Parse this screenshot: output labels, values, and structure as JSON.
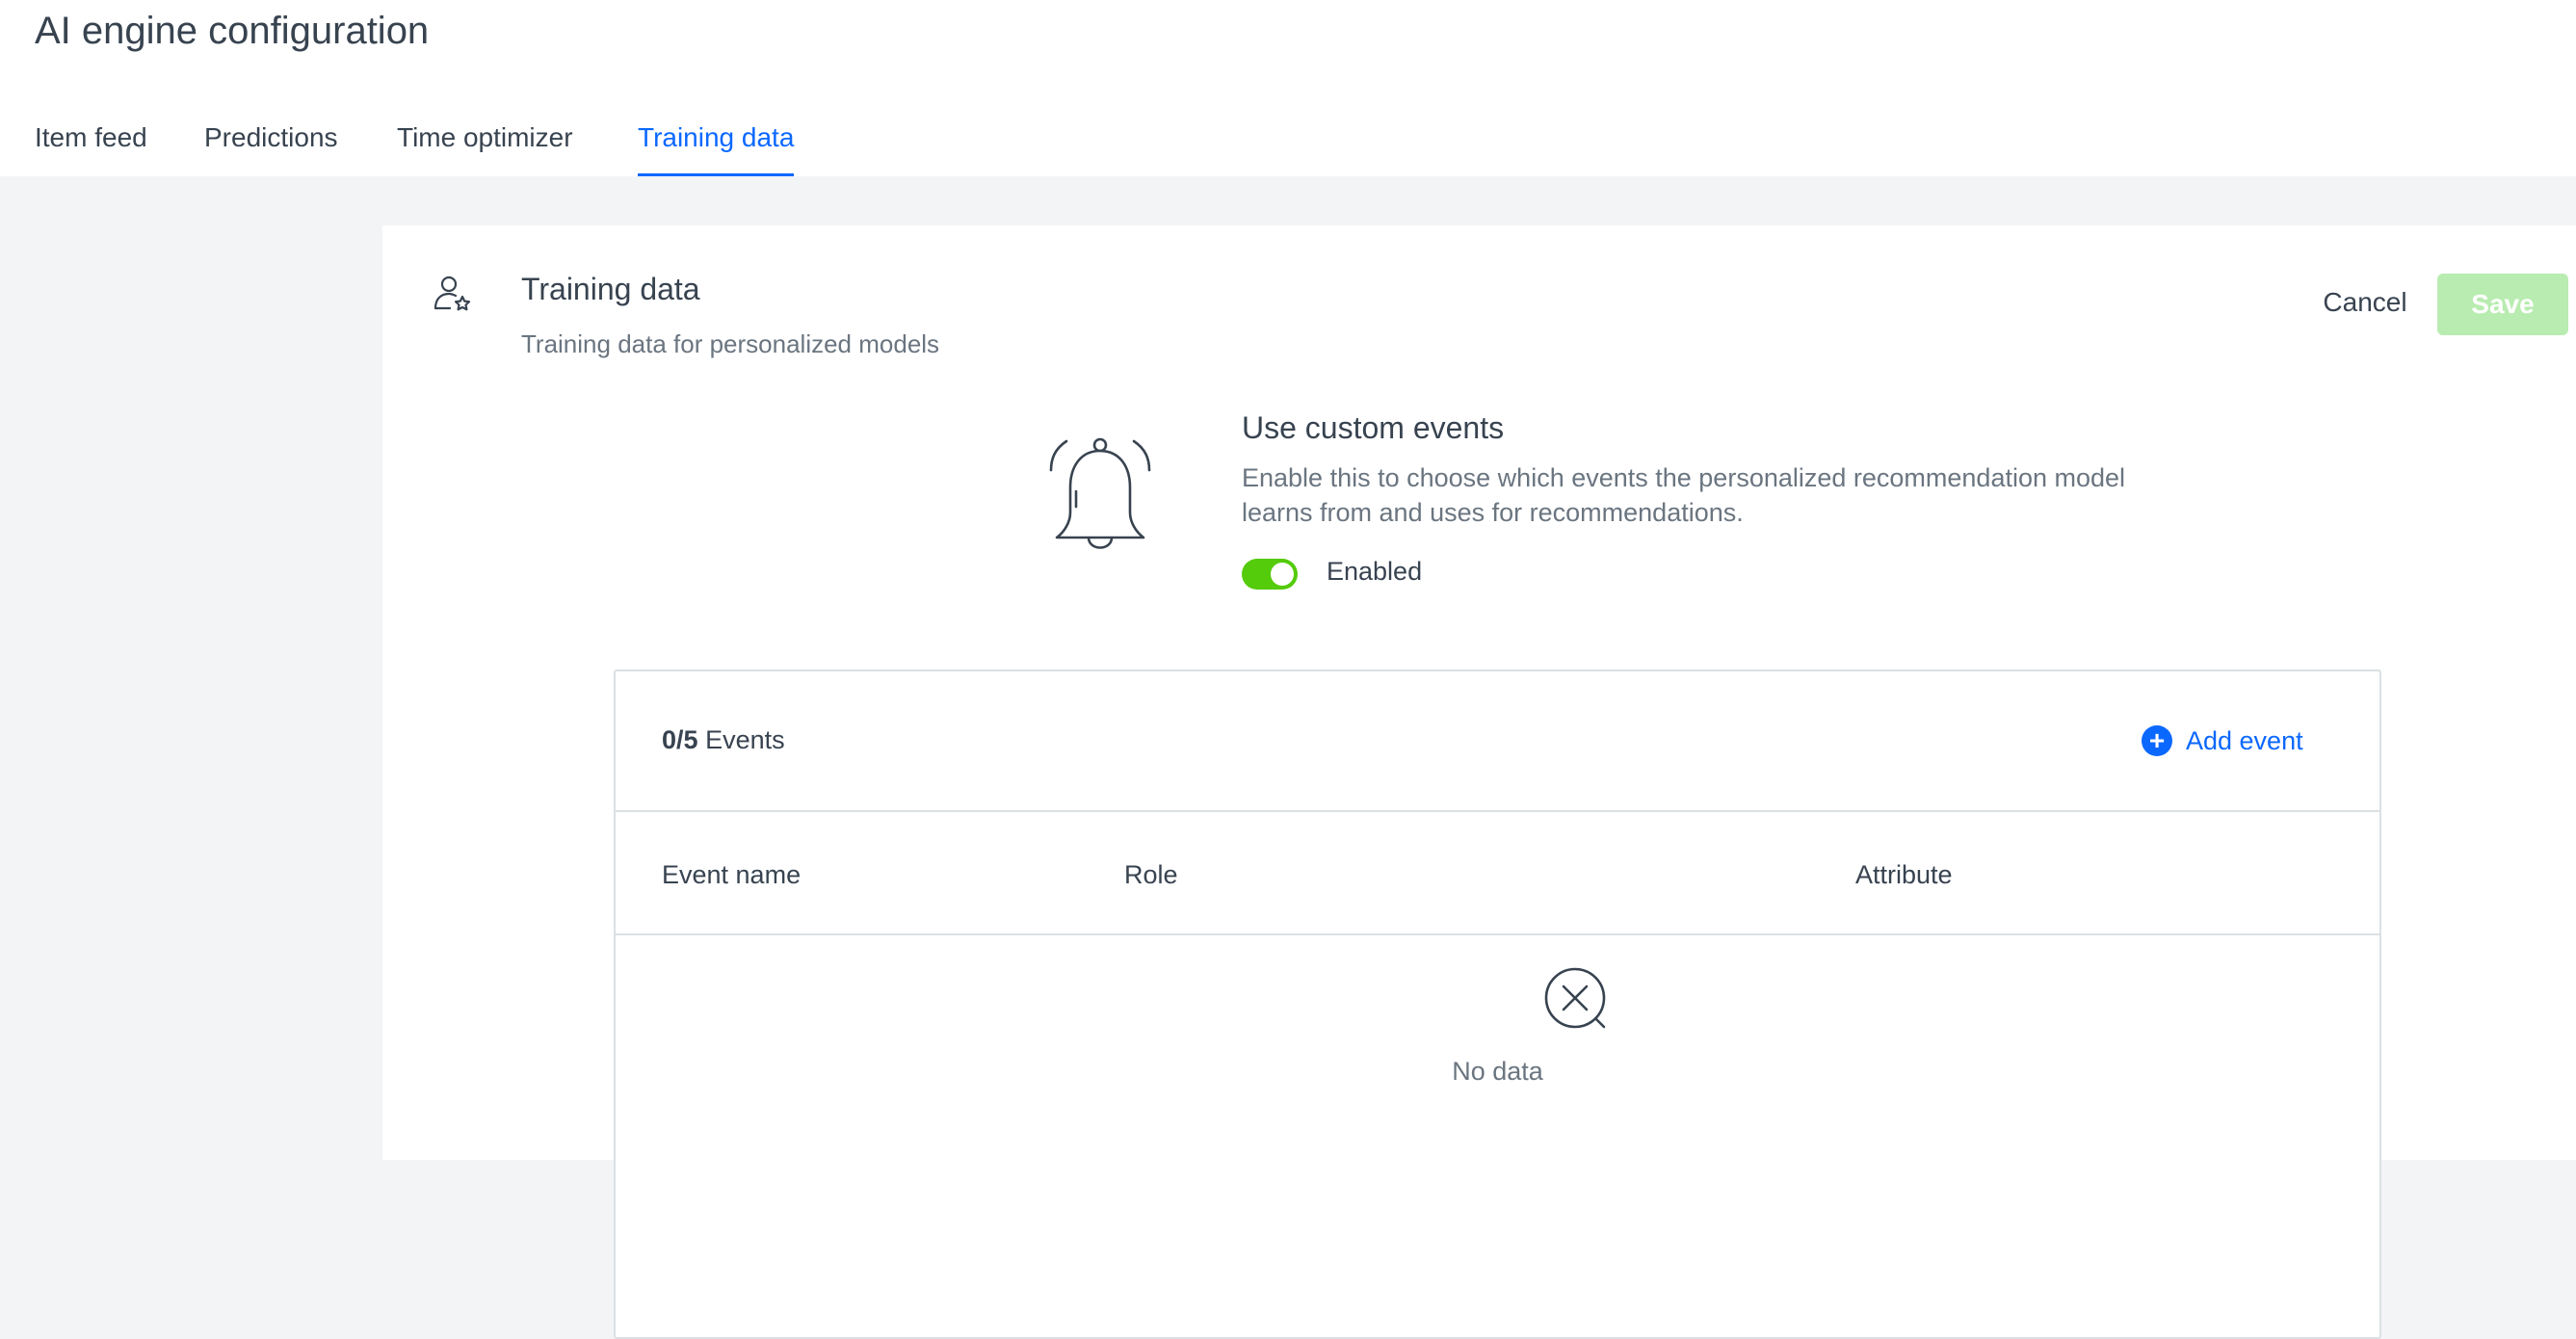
{
  "page": {
    "title": "AI engine configuration"
  },
  "tabs": [
    {
      "label": "Item feed"
    },
    {
      "label": "Predictions"
    },
    {
      "label": "Time optimizer"
    },
    {
      "label": "Training data"
    }
  ],
  "active_tab": "Training data",
  "section": {
    "title": "Training data",
    "subtitle": "Training data for personalized models",
    "icon": "user-star-icon",
    "cancel_label": "Cancel",
    "save_label": "Save"
  },
  "custom_events": {
    "title": "Use custom events",
    "description": "Enable this to choose which events the personalized recommendation model learns from and uses for recommendations.",
    "icon": "bell-icon",
    "toggle_on": true,
    "toggle_label": "Enabled"
  },
  "events": {
    "count": "0/5",
    "count_suffix": "Events",
    "add_label": "Add event",
    "columns": [
      "Event name",
      "Role",
      "Attribute"
    ],
    "empty_text": "No data"
  },
  "colors": {
    "accent": "#0b68ff",
    "toggle_on": "#54cb0b",
    "save_disabled": "#b8ecb0",
    "text": "#384350",
    "muted": "#6a7580",
    "background": "#f3f4f6"
  }
}
